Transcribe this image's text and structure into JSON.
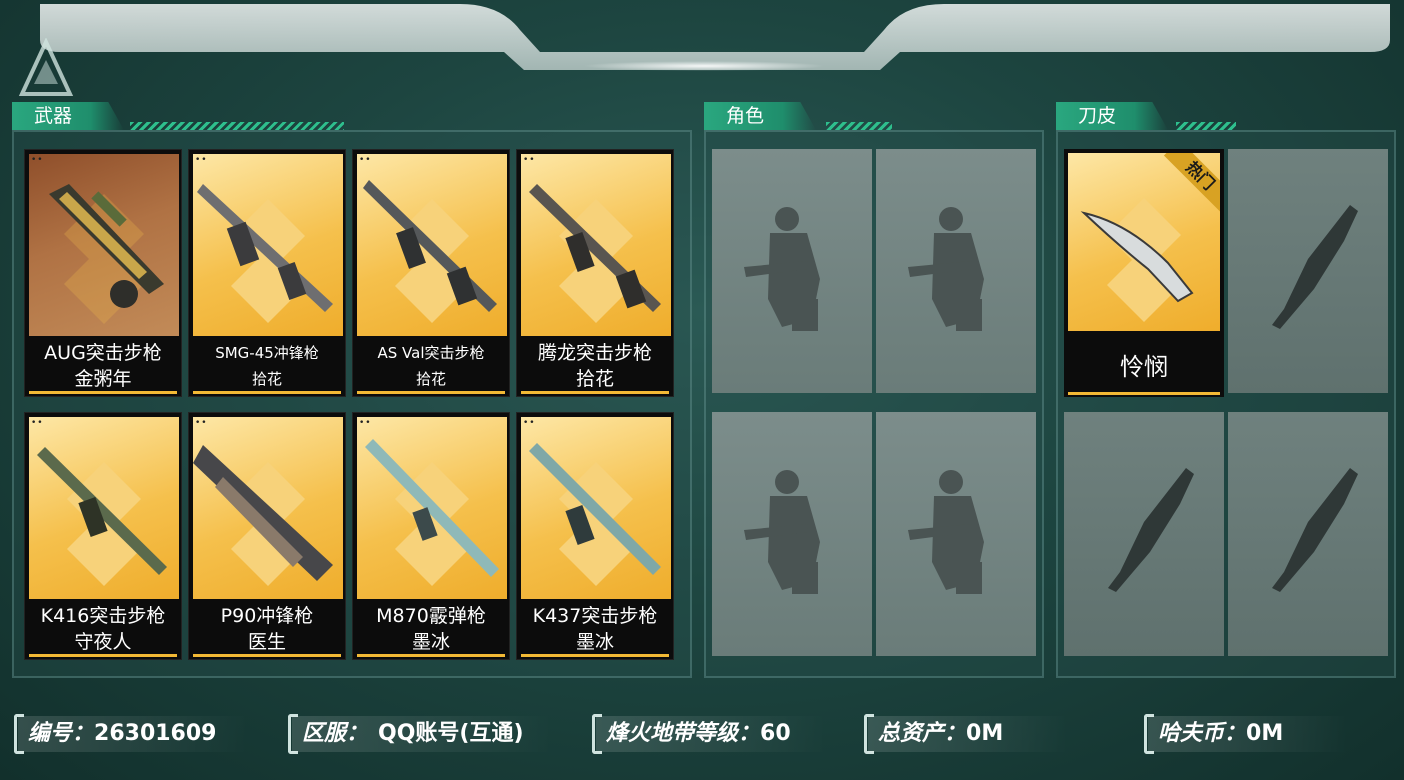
{
  "sections": {
    "weapons": "武器",
    "roles": "角色",
    "skins": "刀皮"
  },
  "weapons": [
    {
      "line1": "AUG突击步枪",
      "line2": "金粥年",
      "special": true
    },
    {
      "line1": "SMG-45冲锋枪",
      "line2": "拾花"
    },
    {
      "line1": "AS Val突击步枪",
      "line2": "拾花"
    },
    {
      "line1": "腾龙突击步枪",
      "line2": "拾花"
    },
    {
      "line1": "K416突击步枪",
      "line2": "守夜人"
    },
    {
      "line1": "P90冲锋枪",
      "line2": "医生"
    },
    {
      "line1": "M870霰弹枪",
      "line2": "墨冰"
    },
    {
      "line1": "K437突击步枪",
      "line2": "墨冰"
    }
  ],
  "knife": {
    "name": "怜悯",
    "badge": "热门"
  },
  "footer": {
    "id_label": "编号：",
    "id_value": "26301609",
    "server_label": "区服：",
    "server_value": "QQ账号(互通)",
    "level_label": "烽火地带等级：",
    "level_value": "60",
    "assets_label": "总资产：",
    "assets_value": "0M",
    "coin_label": "哈夫币：",
    "coin_value": "0M"
  },
  "colors": {
    "accent": "#2aa77f",
    "card_gold": "#f5c04c",
    "background": "#1d4540"
  },
  "icons": [
    "game-logo-icon",
    "soldier-silhouette-icon",
    "knife-silhouette-icon"
  ]
}
